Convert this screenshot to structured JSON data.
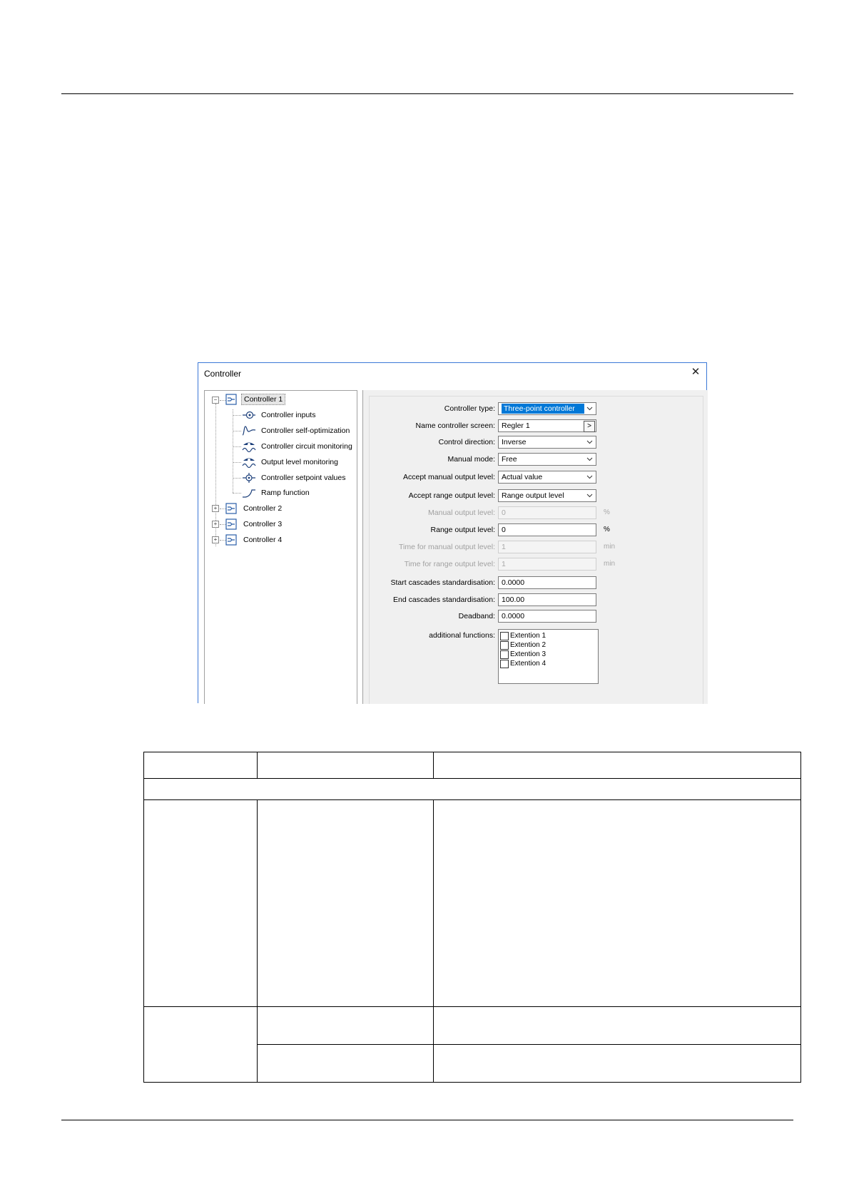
{
  "dialog": {
    "title": "Controller",
    "close_glyph": "✕",
    "tree": {
      "controllers": [
        {
          "label": "Controller 1",
          "expanded": true,
          "selected": true
        },
        {
          "label": "Controller 2",
          "expanded": false
        },
        {
          "label": "Controller 3",
          "expanded": false
        },
        {
          "label": "Controller 4",
          "expanded": false
        }
      ],
      "children": [
        {
          "label": "Controller inputs",
          "icon": "controller-inputs-icon"
        },
        {
          "label": "Controller self-optimization",
          "icon": "self-optimization-icon"
        },
        {
          "label": "Controller circuit monitoring",
          "icon": "circuit-monitoring-icon"
        },
        {
          "label": "Output level monitoring",
          "icon": "output-monitoring-icon"
        },
        {
          "label": "Controller setpoint values",
          "icon": "setpoint-icon"
        },
        {
          "label": "Ramp function",
          "icon": "ramp-icon"
        }
      ]
    },
    "form": {
      "controller_type": {
        "label": "Controller type:",
        "value": "Three-point controller"
      },
      "name_controller_screen": {
        "label": "Name controller screen:",
        "value": "Regler 1",
        "button": ">"
      },
      "control_direction": {
        "label": "Control direction:",
        "value": "Inverse"
      },
      "manual_mode": {
        "label": "Manual mode:",
        "value": "Free"
      },
      "accept_manual_output": {
        "label": "Accept manual output level:",
        "value": "Actual value"
      },
      "accept_range_output": {
        "label": "Accept range output level:",
        "value": "Range output level"
      },
      "manual_output_level": {
        "label": "Manual output level:",
        "value": "0",
        "unit": "%",
        "disabled": true
      },
      "range_output_level": {
        "label": "Range output level:",
        "value": "0",
        "unit": "%"
      },
      "time_manual_output": {
        "label": "Time for manual output level:",
        "value": "1",
        "unit": "min",
        "disabled": true
      },
      "time_range_output": {
        "label": "Time for range output level:",
        "value": "1",
        "unit": "min",
        "disabled": true
      },
      "start_cascades": {
        "label": "Start cascades standardisation:",
        "value": "0.0000"
      },
      "end_cascades": {
        "label": "End cascades standardisation:",
        "value": "100.00"
      },
      "deadband": {
        "label": "Deadband:",
        "value": "0.0000"
      },
      "additional_functions": {
        "label": "additional functions:",
        "options": [
          "Extention 1",
          "Extention 2",
          "Extention 3",
          "Extention 4"
        ]
      }
    }
  },
  "colors": {
    "accent": "#0078d7",
    "dialog_border": "#3b78d7",
    "panel_bg": "#f0f0f0",
    "disabled_text": "#a0a0a0"
  }
}
